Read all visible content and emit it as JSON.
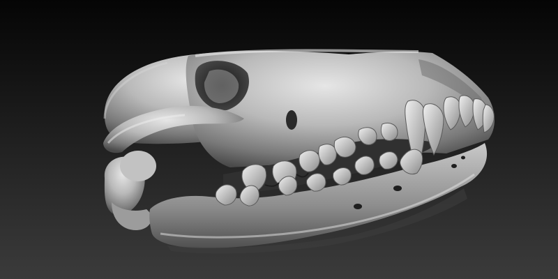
{
  "scene": {
    "subject": "skull-render",
    "colors": {
      "background_top": "#050505",
      "background_bottom": "#3b3b3b",
      "bone_light": "#dcdcdc",
      "bone_mid": "#a9a9a9",
      "bone_dark": "#5e5e5e",
      "cavity": "#1a1a1a"
    }
  }
}
